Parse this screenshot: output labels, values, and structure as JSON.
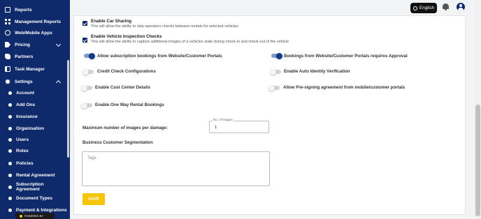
{
  "sidebar": {
    "items": [
      {
        "label": "Reports",
        "icon": "report-icon"
      },
      {
        "label": "Management Reports",
        "icon": "management-reports-icon"
      },
      {
        "label": "Web/Mobile Apps",
        "icon": "globe-icon"
      },
      {
        "label": "Pricing",
        "icon": "pricing-icon"
      },
      {
        "label": "Partners",
        "icon": "partners-icon"
      },
      {
        "label": "Task Manager",
        "icon": "task-icon"
      },
      {
        "label": "Settings",
        "icon": "gear-icon"
      }
    ],
    "sub_items": [
      "Account",
      "Add Ons",
      "Insurance",
      "Organisation",
      "Users",
      "Roles",
      "Policies",
      "Rental Agreement",
      "Subscription Agreement",
      "Document Types",
      "Payment & Integrations"
    ],
    "powered_by": "POWERED BY"
  },
  "topbar": {
    "language_label": "English"
  },
  "settings": {
    "checkboxes": [
      {
        "title": "Enable Car Sharing",
        "description": "This will allow the ability to skip operators checks between rentals for selected vehicles",
        "checked": true
      },
      {
        "title": "Enable Vehicle Inspection Checks",
        "description": "This will allow the ability to capture additional images of a vehicles state during check-in and check-out of the vehicle",
        "checked": true
      }
    ],
    "toggles_left": [
      {
        "label": "Allow subscription bookings from Website/Customer Portals",
        "on": true
      },
      {
        "label": "Credit Check Configurations",
        "on": false
      },
      {
        "label": "Enable Cost Center Details",
        "on": false
      },
      {
        "label": "Enable One Way Rental Bookings",
        "on": false
      }
    ],
    "toggles_right": [
      {
        "label": "Bookings from Website/Customer Portals requires Approval",
        "on": true
      },
      {
        "label": "Enable Auto Identity Verification",
        "on": false
      },
      {
        "label": "Allow Pre-signing agreement from mobile/customer portals",
        "on": false
      }
    ],
    "max_images_label": "Maximum number of images per damage:",
    "max_images_legend": "No. of images",
    "max_images_value": "1",
    "segmentation_label": "Business Customer Segmentation",
    "tags_placeholder": "Tags",
    "save_label": "SAVE"
  }
}
